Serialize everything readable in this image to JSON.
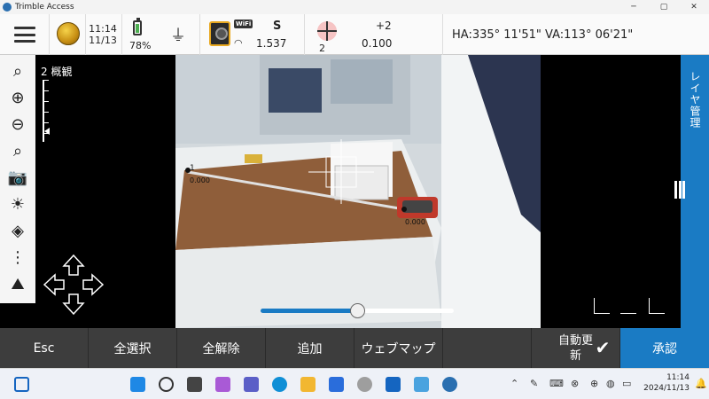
{
  "window": {
    "title": "Trimble Access",
    "controls": [
      "─",
      "▢",
      "✕"
    ]
  },
  "status": {
    "time": "11:14",
    "date": "11/13",
    "battery": "78%",
    "battery_level": 0.78,
    "wifi_badge": "WiFi",
    "s_label": "S",
    "s_value": "1.537",
    "target_num": "2",
    "plus": "+2",
    "offset": "0.100",
    "hava": "HA:335°  11'51\"  VA:113°  06'21\""
  },
  "view": {
    "scale_label": "2 概観",
    "point1_label": "1",
    "point1_value": "0.000",
    "point2_value": "0.000",
    "zoom_fraction": 0.5,
    "right_panel_label": "レイヤ管理"
  },
  "tools": [
    {
      "name": "zoom-extents-icon",
      "glyph": "⌕"
    },
    {
      "name": "zoom-in-icon",
      "glyph": "⊕"
    },
    {
      "name": "zoom-out-icon",
      "glyph": "⊖"
    },
    {
      "name": "zoom-window-icon",
      "glyph": "⌕"
    },
    {
      "name": "camera-icon",
      "glyph": "📷"
    },
    {
      "name": "brightness-icon",
      "glyph": "☀"
    },
    {
      "name": "layers-icon",
      "glyph": "◈"
    },
    {
      "name": "more-icon",
      "glyph": "⋮"
    },
    {
      "name": "map-icon",
      "glyph": "⛰"
    }
  ],
  "actions": {
    "esc": "Esc",
    "select_all": "全選択",
    "deselect_all": "全解除",
    "add": "追加",
    "web_map": "ウェブマップ",
    "auto_update_1": "自動更",
    "auto_update_2": "新",
    "accept": "承認"
  },
  "taskbar": {
    "time": "11:14",
    "date": "2024/11/13"
  },
  "colors": {
    "accent": "#1a7bc4",
    "actionbar": "#3d3d3d"
  }
}
